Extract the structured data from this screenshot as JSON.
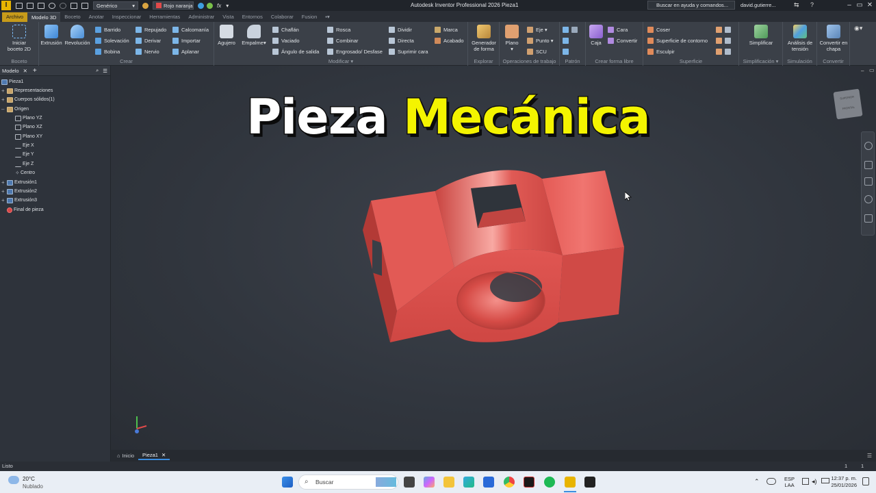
{
  "qat": {
    "appearance_dropdown": "Genérico",
    "material_dropdown": "Rojo naranja"
  },
  "app_title": "Autodesk Inventor Professional 2026    Pieza1",
  "search_help": "Buscar en ayuda y comandos...",
  "user": "david.gutierre...",
  "tabs": [
    "Archivo",
    "Modelo 3D",
    "Boceto",
    "Anotar",
    "Inspeccionar",
    "Herramientas",
    "Administrar",
    "Vista",
    "Entornos",
    "Colaborar",
    "Fusion"
  ],
  "ribbon": {
    "boceto": {
      "label": "Boceto",
      "start_sketch": "Iniciar boceto 2D"
    },
    "crear": {
      "label": "Crear",
      "extrusion": "Extrusión",
      "revolucion": "Revolución",
      "barrido": "Barrido",
      "solevacion": "Solevación",
      "bobina": "Bobina",
      "repujado": "Repujado",
      "derivar": "Derivar",
      "nervio": "Nervio",
      "calcomania": "Calcomanía",
      "importar": "Importar",
      "aplanar": "Aplanar"
    },
    "modificar": {
      "label": "Modificar",
      "agujero": "Agujero",
      "empalme": "Empalme",
      "chaflan": "Chaflán",
      "vaciado": "Vaciado",
      "angulo": "Ángulo de salida",
      "rosca": "Rosca",
      "combinar": "Combinar",
      "engrosado": "Engrosado/ Desfase",
      "dividir": "Dividir",
      "directa": "Directa",
      "suprimir": "Suprimir cara",
      "marca": "Marca",
      "acabado": "Acabado"
    },
    "explorar": {
      "label": "Explorar",
      "generador": "Generador de forma"
    },
    "operaciones": {
      "label": "Operaciones de trabajo",
      "plano": "Plano",
      "eje": "Eje",
      "punto": "Punto",
      "scu": "SCU"
    },
    "patron": {
      "label": "Patrón"
    },
    "forma_libre": {
      "label": "Crear forma libre",
      "caja": "Caja",
      "cara": "Cara",
      "convertir": "Convertir"
    },
    "superficie": {
      "label": "Superficie",
      "coser": "Coser",
      "contorno": "Superficie de contorno",
      "esculpir": "Esculpir"
    },
    "simplificacion": {
      "label": "Simplificación",
      "simplificar": "Simplificar"
    },
    "simulacion": {
      "label": "Simulación",
      "analisis": "Análisis de tensión"
    },
    "convertir": {
      "label": "Convertir",
      "chapa": "Convertir en chapa"
    }
  },
  "browser": {
    "tab": "Modelo",
    "items": [
      {
        "label": "Pieza1"
      },
      {
        "label": "Representaciones"
      },
      {
        "label": "Cuerpos sólidos(1)"
      },
      {
        "label": "Origen"
      },
      {
        "label": "Plano YZ"
      },
      {
        "label": "Plano XZ"
      },
      {
        "label": "Plano XY"
      },
      {
        "label": "Eje X"
      },
      {
        "label": "Eje Y"
      },
      {
        "label": "Eje Z"
      },
      {
        "label": "Centro"
      },
      {
        "label": "Extrusión1"
      },
      {
        "label": "Extrusión2"
      },
      {
        "label": "Extrusión3"
      },
      {
        "label": "Final de pieza"
      }
    ]
  },
  "overlay_title": {
    "word1": "Pieza",
    "word2": "Mecánica"
  },
  "viewcube": {
    "top": "SUPERIOR",
    "front": "FRONTAL"
  },
  "doc_tabs": {
    "home": "Inicio",
    "part": "Pieza1"
  },
  "status": {
    "text": "Listo",
    "count1": "1",
    "count2": "1"
  },
  "taskbar": {
    "weather_temp": "20°C",
    "weather_desc": "Nublado",
    "search": "Buscar",
    "lang1": "ESP",
    "lang2": "LAA",
    "time": "12:37 p. m.",
    "date": "25/01/2026"
  },
  "colors": {
    "part": "#e04a4a",
    "title_yellow": "#f4f400",
    "file_tab": "#c79b1a"
  }
}
